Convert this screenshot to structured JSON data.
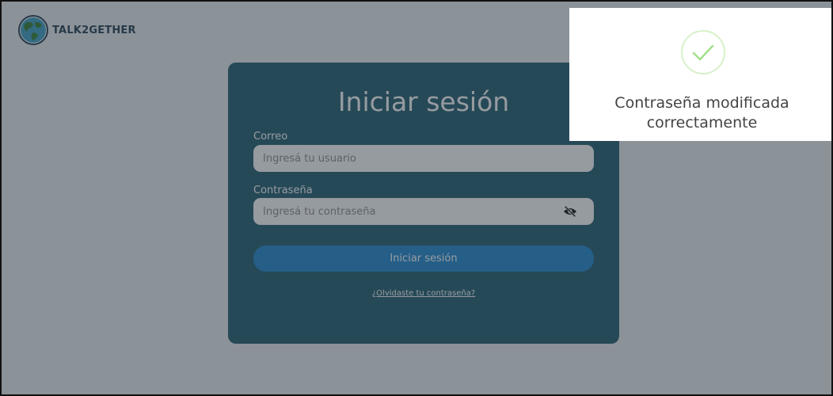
{
  "brand": {
    "name": "TALK2GETHER",
    "logo_icon": "globe-icon"
  },
  "login": {
    "title": "Iniciar sesión",
    "email_label": "Correo",
    "email_placeholder": "Ingresá tu usuario",
    "email_value": "",
    "password_label": "Contraseña",
    "password_placeholder": "Ingresá tu contraseña",
    "password_value": "",
    "toggle_icon": "eye-slash-icon",
    "submit_label": "Iniciar sesión",
    "forgot_link": "¿Olvidaste tu contraseña?"
  },
  "toast": {
    "icon": "check-circle-icon",
    "message_line1": "Contraseña modificada",
    "message_line2": "correctamente"
  },
  "colors": {
    "card": "#1f5b6c",
    "button": "#1c86cf",
    "overlay": "rgba(45,55,65,0.5)",
    "check": "#a3e08a"
  }
}
